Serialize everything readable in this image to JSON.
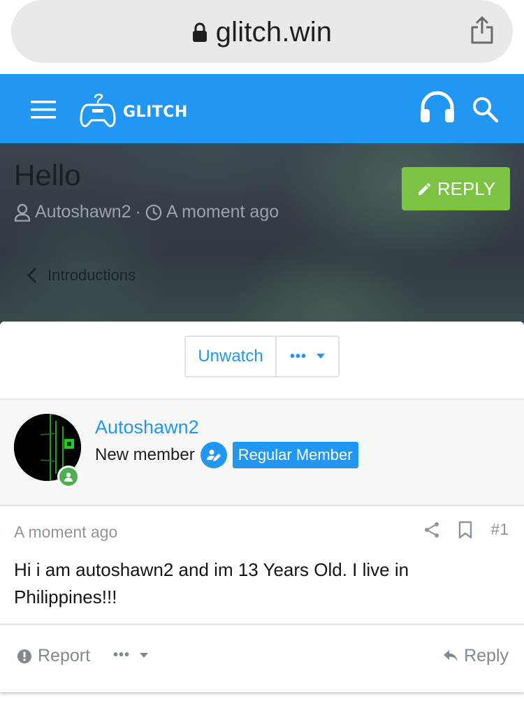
{
  "browser": {
    "url": "glitch.win",
    "icons": {
      "lock": "lock-icon",
      "share": "share-icon"
    }
  },
  "header": {
    "logo_text": "GLITCH",
    "icons": [
      "menu-icon",
      "gamepad-logo-icon",
      "headphones-icon",
      "search-icon"
    ],
    "color": "#2196f3"
  },
  "thread": {
    "title": "Hello",
    "author": "Autoshawn2",
    "separator": "·",
    "time": "A moment ago",
    "reply_label": "REPLY",
    "breadcrumb": "Introductions",
    "reply_color": "#7cc243"
  },
  "watch": {
    "unwatch_label": "Unwatch",
    "more_label": "•••"
  },
  "post": {
    "author": "Autoshawn2",
    "member_title": "New member",
    "badge": "Regular Member",
    "time": "A moment ago",
    "number": "#1",
    "body": "Hi i am autoshawn2 and im 13 Years Old. I live in Philippines!!!"
  },
  "actions": {
    "report": "Report",
    "more": "•••",
    "reply": "Reply"
  }
}
